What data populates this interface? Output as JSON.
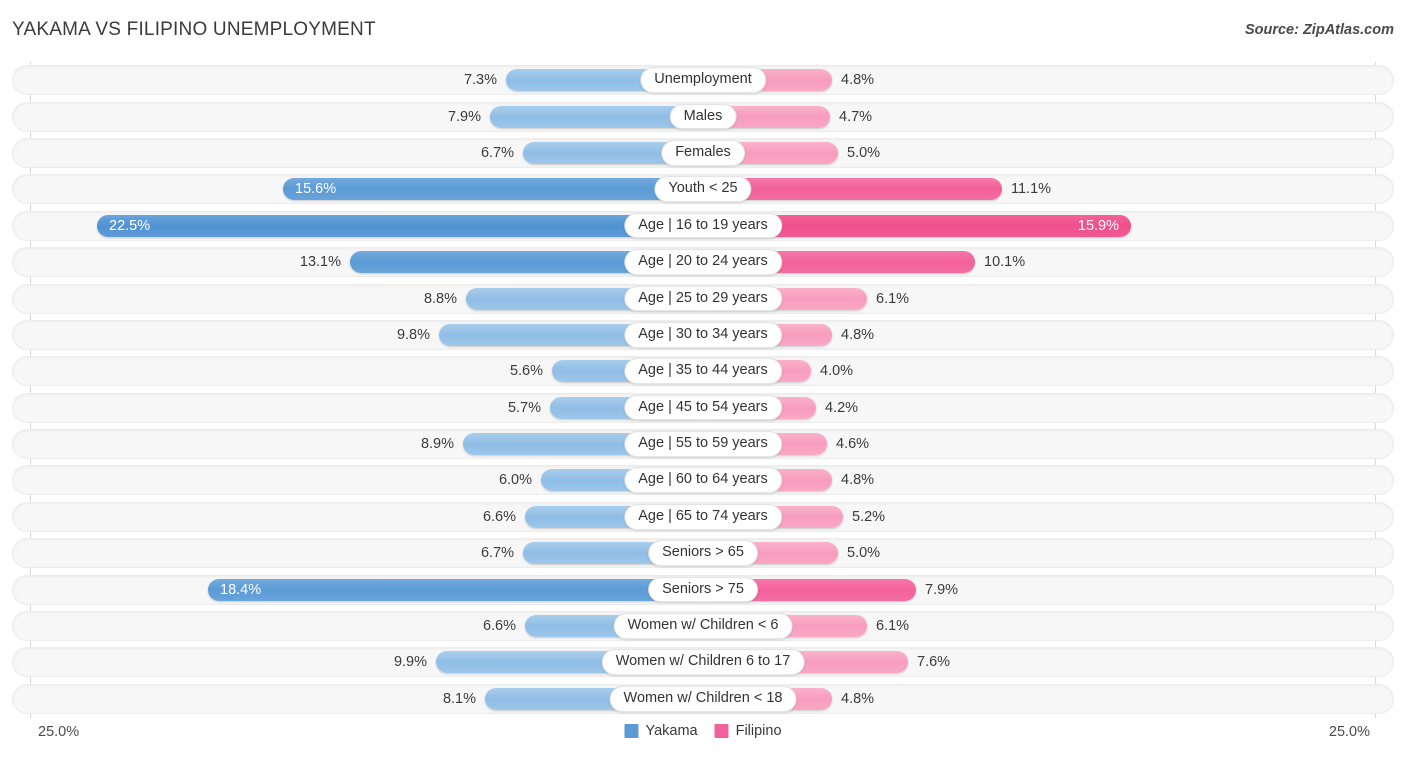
{
  "header": {
    "title": "YAKAMA VS FILIPINO UNEMPLOYMENT",
    "source": "Source: ZipAtlas.com"
  },
  "axis": {
    "min_label": "25.0%",
    "max_label": "25.0%"
  },
  "legend": {
    "items": [
      {
        "label": "Yakama",
        "color": "#5b9bd5"
      },
      {
        "label": "Filipino",
        "color": "#f2629a"
      }
    ]
  },
  "colors": {
    "left_light": "#9dc7ea",
    "left_mid": "#69a3da",
    "left_dark": "#5b9bd5",
    "right_light": "#f9a8c4",
    "right_mid": "#f46ca1",
    "right_dark": "#f2629a",
    "track": "#f7f7f7"
  },
  "chart_data": {
    "type": "bar",
    "title": "YAKAMA VS FILIPINO UNEMPLOYMENT",
    "subtitle": "",
    "xlabel": "",
    "ylabel": "",
    "orientation": "horizontal-diverging",
    "axis_max_percent": 25.0,
    "grid": false,
    "legend_position": "bottom-center",
    "categories": [
      "Unemployment",
      "Males",
      "Females",
      "Youth < 25",
      "Age | 16 to 19 years",
      "Age | 20 to 24 years",
      "Age | 25 to 29 years",
      "Age | 30 to 34 years",
      "Age | 35 to 44 years",
      "Age | 45 to 54 years",
      "Age | 55 to 59 years",
      "Age | 60 to 64 years",
      "Age | 65 to 74 years",
      "Seniors > 65",
      "Seniors > 75",
      "Women w/ Children < 6",
      "Women w/ Children 6 to 17",
      "Women w/ Children < 18"
    ],
    "series": [
      {
        "name": "Yakama",
        "side": "left",
        "color": "#9dc7ea",
        "values": [
          7.3,
          7.9,
          6.7,
          15.6,
          22.5,
          13.1,
          8.8,
          9.8,
          5.6,
          5.7,
          8.9,
          6.0,
          6.6,
          6.7,
          18.4,
          6.6,
          9.9,
          8.1
        ],
        "labels": [
          "7.3%",
          "7.9%",
          "6.7%",
          "15.6%",
          "22.5%",
          "13.1%",
          "8.8%",
          "9.8%",
          "5.6%",
          "5.7%",
          "8.9%",
          "6.0%",
          "6.6%",
          "6.7%",
          "18.4%",
          "6.6%",
          "9.9%",
          "8.1%"
        ]
      },
      {
        "name": "Filipino",
        "side": "right",
        "color": "#f9a8c4",
        "values": [
          4.8,
          4.7,
          5.0,
          11.1,
          15.9,
          10.1,
          6.1,
          4.8,
          4.0,
          4.2,
          4.6,
          4.8,
          5.2,
          5.0,
          7.9,
          6.1,
          7.6,
          4.8
        ],
        "labels": [
          "4.8%",
          "4.7%",
          "5.0%",
          "11.1%",
          "15.9%",
          "10.1%",
          "6.1%",
          "4.8%",
          "4.0%",
          "4.2%",
          "4.6%",
          "4.8%",
          "5.2%",
          "5.0%",
          "7.9%",
          "6.1%",
          "7.6%",
          "4.8%"
        ]
      }
    ]
  },
  "rows": [
    {
      "label": "Unemployment",
      "left": {
        "value": 7.3,
        "text": "7.3%",
        "emphasis": 0,
        "inside": false
      },
      "right": {
        "value": 4.8,
        "text": "4.8%",
        "emphasis": 0,
        "inside": false
      }
    },
    {
      "label": "Males",
      "left": {
        "value": 7.9,
        "text": "7.9%",
        "emphasis": 0,
        "inside": false
      },
      "right": {
        "value": 4.7,
        "text": "4.7%",
        "emphasis": 0,
        "inside": false
      }
    },
    {
      "label": "Females",
      "left": {
        "value": 6.7,
        "text": "6.7%",
        "emphasis": 0,
        "inside": false
      },
      "right": {
        "value": 5.0,
        "text": "5.0%",
        "emphasis": 0,
        "inside": false
      }
    },
    {
      "label": "Youth < 25",
      "left": {
        "value": 15.6,
        "text": "15.6%",
        "emphasis": 1,
        "inside": true
      },
      "right": {
        "value": 11.1,
        "text": "11.1%",
        "emphasis": 1,
        "inside": false
      }
    },
    {
      "label": "Age | 16 to 19 years",
      "left": {
        "value": 22.5,
        "text": "22.5%",
        "emphasis": 2,
        "inside": true
      },
      "right": {
        "value": 15.9,
        "text": "15.9%",
        "emphasis": 2,
        "inside": true
      }
    },
    {
      "label": "Age | 20 to 24 years",
      "left": {
        "value": 13.1,
        "text": "13.1%",
        "emphasis": 1,
        "inside": false
      },
      "right": {
        "value": 10.1,
        "text": "10.1%",
        "emphasis": 1,
        "inside": false
      }
    },
    {
      "label": "Age | 25 to 29 years",
      "left": {
        "value": 8.8,
        "text": "8.8%",
        "emphasis": 0,
        "inside": false
      },
      "right": {
        "value": 6.1,
        "text": "6.1%",
        "emphasis": 0,
        "inside": false
      }
    },
    {
      "label": "Age | 30 to 34 years",
      "left": {
        "value": 9.8,
        "text": "9.8%",
        "emphasis": 0,
        "inside": false
      },
      "right": {
        "value": 4.8,
        "text": "4.8%",
        "emphasis": 0,
        "inside": false
      }
    },
    {
      "label": "Age | 35 to 44 years",
      "left": {
        "value": 5.6,
        "text": "5.6%",
        "emphasis": 0,
        "inside": false
      },
      "right": {
        "value": 4.0,
        "text": "4.0%",
        "emphasis": 0,
        "inside": false
      }
    },
    {
      "label": "Age | 45 to 54 years",
      "left": {
        "value": 5.7,
        "text": "5.7%",
        "emphasis": 0,
        "inside": false
      },
      "right": {
        "value": 4.2,
        "text": "4.2%",
        "emphasis": 0,
        "inside": false
      }
    },
    {
      "label": "Age | 55 to 59 years",
      "left": {
        "value": 8.9,
        "text": "8.9%",
        "emphasis": 0,
        "inside": false
      },
      "right": {
        "value": 4.6,
        "text": "4.6%",
        "emphasis": 0,
        "inside": false
      }
    },
    {
      "label": "Age | 60 to 64 years",
      "left": {
        "value": 6.0,
        "text": "6.0%",
        "emphasis": 0,
        "inside": false
      },
      "right": {
        "value": 4.8,
        "text": "4.8%",
        "emphasis": 0,
        "inside": false
      }
    },
    {
      "label": "Age | 65 to 74 years",
      "left": {
        "value": 6.6,
        "text": "6.6%",
        "emphasis": 0,
        "inside": false
      },
      "right": {
        "value": 5.2,
        "text": "5.2%",
        "emphasis": 0,
        "inside": false
      }
    },
    {
      "label": "Seniors > 65",
      "left": {
        "value": 6.7,
        "text": "6.7%",
        "emphasis": 0,
        "inside": false
      },
      "right": {
        "value": 5.0,
        "text": "5.0%",
        "emphasis": 0,
        "inside": false
      }
    },
    {
      "label": "Seniors > 75",
      "left": {
        "value": 18.4,
        "text": "18.4%",
        "emphasis": 1,
        "inside": true
      },
      "right": {
        "value": 7.9,
        "text": "7.9%",
        "emphasis": 1,
        "inside": false
      }
    },
    {
      "label": "Women w/ Children < 6",
      "left": {
        "value": 6.6,
        "text": "6.6%",
        "emphasis": 0,
        "inside": false
      },
      "right": {
        "value": 6.1,
        "text": "6.1%",
        "emphasis": 0,
        "inside": false
      }
    },
    {
      "label": "Women w/ Children 6 to 17",
      "left": {
        "value": 9.9,
        "text": "9.9%",
        "emphasis": 0,
        "inside": false
      },
      "right": {
        "value": 7.6,
        "text": "7.6%",
        "emphasis": 0,
        "inside": false
      }
    },
    {
      "label": "Women w/ Children < 18",
      "left": {
        "value": 8.1,
        "text": "8.1%",
        "emphasis": 0,
        "inside": false
      },
      "right": {
        "value": 4.8,
        "text": "4.8%",
        "emphasis": 0,
        "inside": false
      }
    }
  ]
}
